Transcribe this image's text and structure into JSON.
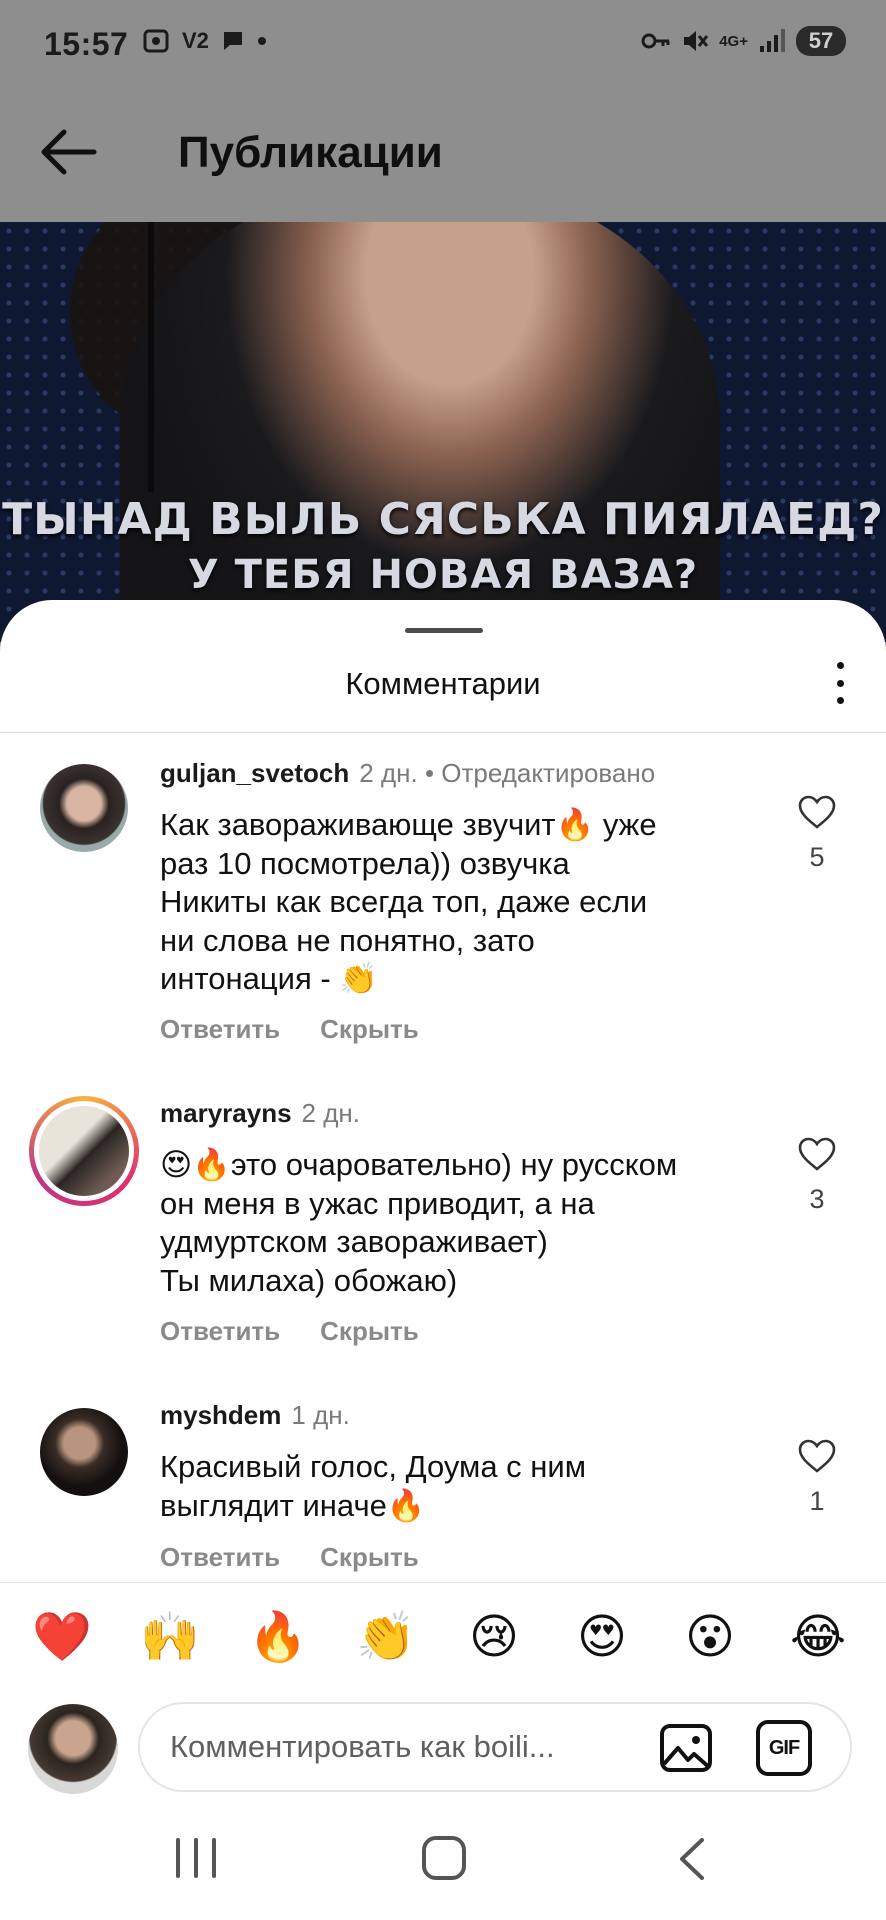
{
  "status_bar": {
    "time": "15:57",
    "left_icons": [
      "screen-record-icon",
      "v2-label",
      "chat-bubble-icon",
      "dot-icon"
    ],
    "v2_label": "V2",
    "network_label": "4G+",
    "battery": "57"
  },
  "header": {
    "title": "Публикации"
  },
  "video": {
    "subtitle_line1": "ТЫНАД ВЫЛЬ СЯСЬКА ПИЯЛАЕД?",
    "subtitle_line2": "У ТЕБЯ НОВАЯ ВАЗА?"
  },
  "sheet": {
    "title": "Комментарии"
  },
  "comments": [
    {
      "username": "guljan_svetoch",
      "time": "2 дн.",
      "edited": "• Отредактировано",
      "text_lines": [
        "Как завораживающе звучит🔥 уже",
        "раз 10 посмотрела)) озвучка",
        "Никиты как всегда топ, даже если",
        "ни слова не понятно, зато",
        "интонация - 👏"
      ],
      "likes": "5",
      "reply_label": "Ответить",
      "hide_label": "Скрыть"
    },
    {
      "username": "maryrayns",
      "time": "2 дн.",
      "text_lines": [
        "😍🔥это очаровательно) ну русском",
        "он меня в ужас приводит, а на",
        "удмуртском завораживает)",
        "Ты милаха) обожаю)"
      ],
      "likes": "3",
      "reply_label": "Ответить",
      "hide_label": "Скрыть"
    },
    {
      "username": "myshdem",
      "time": "1 дн.",
      "text_lines": [
        "Красивый голос, Доума с ним",
        "выглядит иначе🔥"
      ],
      "likes": "1",
      "reply_label": "Ответить",
      "hide_label": "Скрыть"
    }
  ],
  "emoji_bar": [
    "❤️",
    "🙌",
    "🔥",
    "👏",
    "😢",
    "😍",
    "😮",
    "😂"
  ],
  "input": {
    "placeholder": "Комментировать как boili...",
    "gif_label": "GIF"
  },
  "colors": {
    "accent_text": "#111111",
    "muted_text": "#8a8a8a",
    "overlay": "#8e8e8e"
  }
}
